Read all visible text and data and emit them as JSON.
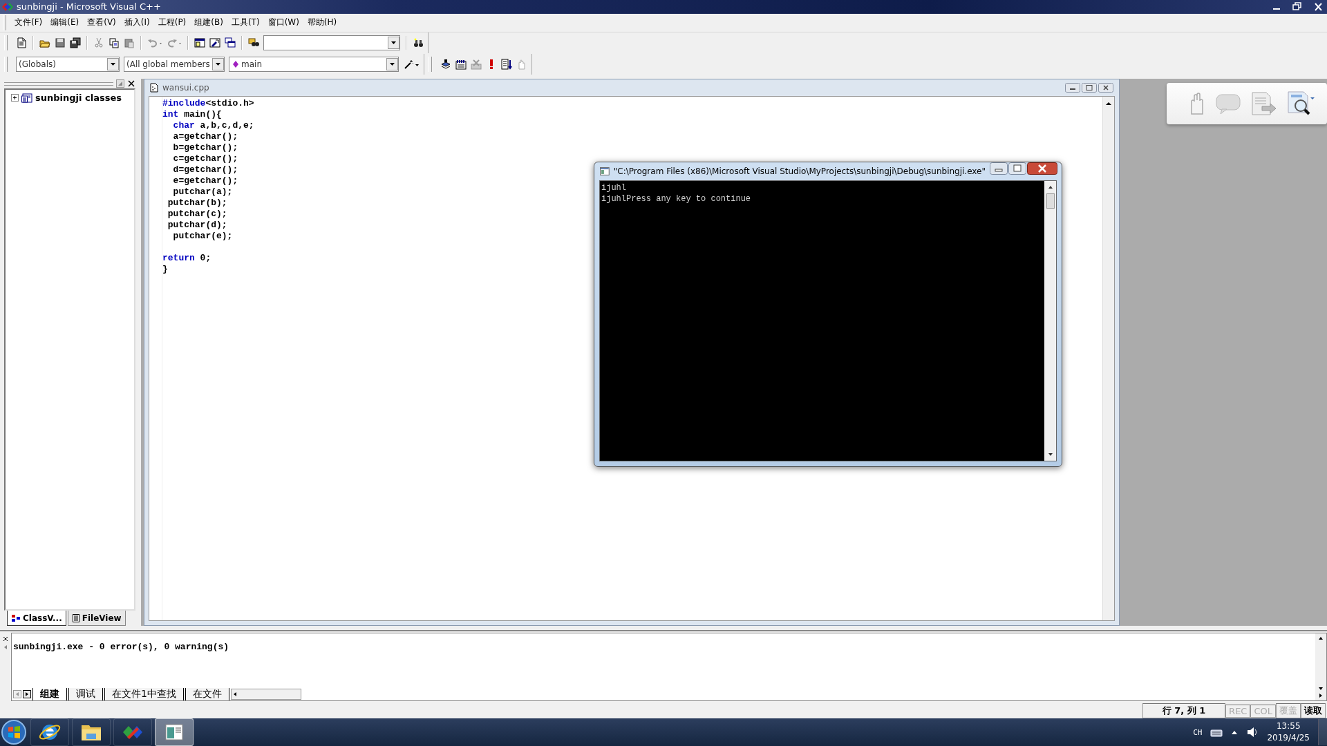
{
  "window": {
    "title": "sunbingji - Microsoft Visual C++"
  },
  "menu": [
    "文件(F)",
    "编辑(E)",
    "查看(V)",
    "插入(I)",
    "工程(P)",
    "组建(B)",
    "工具(T)",
    "窗口(W)",
    "帮助(H)"
  ],
  "wizard_bar": {
    "class": "(Globals)",
    "members": "(All global members",
    "function": "main"
  },
  "workspace": {
    "tree": [
      {
        "label": "sunbingji classes",
        "expanded": false
      }
    ],
    "tabs": [
      {
        "label": "ClassV...",
        "selected": true
      },
      {
        "label": "FileView",
        "selected": false
      }
    ]
  },
  "editor": {
    "title": "wansui.cpp",
    "lines": [
      {
        "tokens": [
          {
            "text": "#include",
            "kind": "keyword"
          },
          {
            "text": "<stdio.h>",
            "kind": "plain"
          }
        ]
      },
      {
        "tokens": [
          {
            "text": "int",
            "kind": "keyword"
          },
          {
            "text": " main(){",
            "kind": "plain"
          }
        ]
      },
      {
        "tokens": [
          {
            "text": "  char",
            "kind": "keyword"
          },
          {
            "text": " a,b,c,d,e;",
            "kind": "plain"
          }
        ]
      },
      {
        "tokens": [
          {
            "text": "  a=getchar();",
            "kind": "plain"
          }
        ]
      },
      {
        "tokens": [
          {
            "text": "  b=getchar();",
            "kind": "plain"
          }
        ]
      },
      {
        "tokens": [
          {
            "text": "  c=getchar();",
            "kind": "plain"
          }
        ]
      },
      {
        "tokens": [
          {
            "text": "  d=getchar();",
            "kind": "plain"
          }
        ]
      },
      {
        "tokens": [
          {
            "text": "  e=getchar();",
            "kind": "plain"
          }
        ]
      },
      {
        "tokens": [
          {
            "text": "  putchar(a);",
            "kind": "plain"
          }
        ]
      },
      {
        "tokens": [
          {
            "text": " putchar(b);",
            "kind": "plain"
          }
        ]
      },
      {
        "tokens": [
          {
            "text": " putchar(c);",
            "kind": "plain"
          }
        ]
      },
      {
        "tokens": [
          {
            "text": " putchar(d);",
            "kind": "plain"
          }
        ]
      },
      {
        "tokens": [
          {
            "text": "  putchar(e);",
            "kind": "plain"
          }
        ]
      },
      {
        "gap_before": true,
        "tokens": [
          {
            "text": "return",
            "kind": "keyword"
          },
          {
            "text": " 0;",
            "kind": "plain"
          }
        ]
      },
      {
        "tokens": [
          {
            "text": "}",
            "kind": "plain"
          }
        ]
      }
    ]
  },
  "console": {
    "title": "\"C:\\Program Files (x86)\\Microsoft Visual Studio\\MyProjects\\sunbingji\\Debug\\sunbingji.exe\"",
    "lines": [
      "ijuhl",
      "ijuhlPress any key to continue"
    ]
  },
  "output": {
    "lines": [
      "sunbingji.exe - 0 error(s), 0 warning(s)"
    ],
    "tabs": [
      {
        "label": "组建",
        "selected": true
      },
      {
        "label": "调试",
        "selected": false
      },
      {
        "label": "在文件1中查找",
        "selected": false
      },
      {
        "label": "在文件",
        "selected": false
      }
    ]
  },
  "status_bar": [
    {
      "text": "行 7, 列 1",
      "disabled": false
    },
    {
      "text": "REC",
      "disabled": true
    },
    {
      "text": "COL",
      "disabled": true
    },
    {
      "text": "覆盖",
      "disabled": true
    },
    {
      "text": "读取",
      "disabled": false
    }
  ],
  "taskbar": {
    "apps": [
      {
        "kind": "browser",
        "selected": false
      },
      {
        "kind": "folder",
        "selected": false
      },
      {
        "kind": "ide",
        "selected": false
      },
      {
        "kind": "console",
        "selected": true
      }
    ],
    "language": "CH",
    "time": "13:55",
    "date": "2019/4/25"
  }
}
